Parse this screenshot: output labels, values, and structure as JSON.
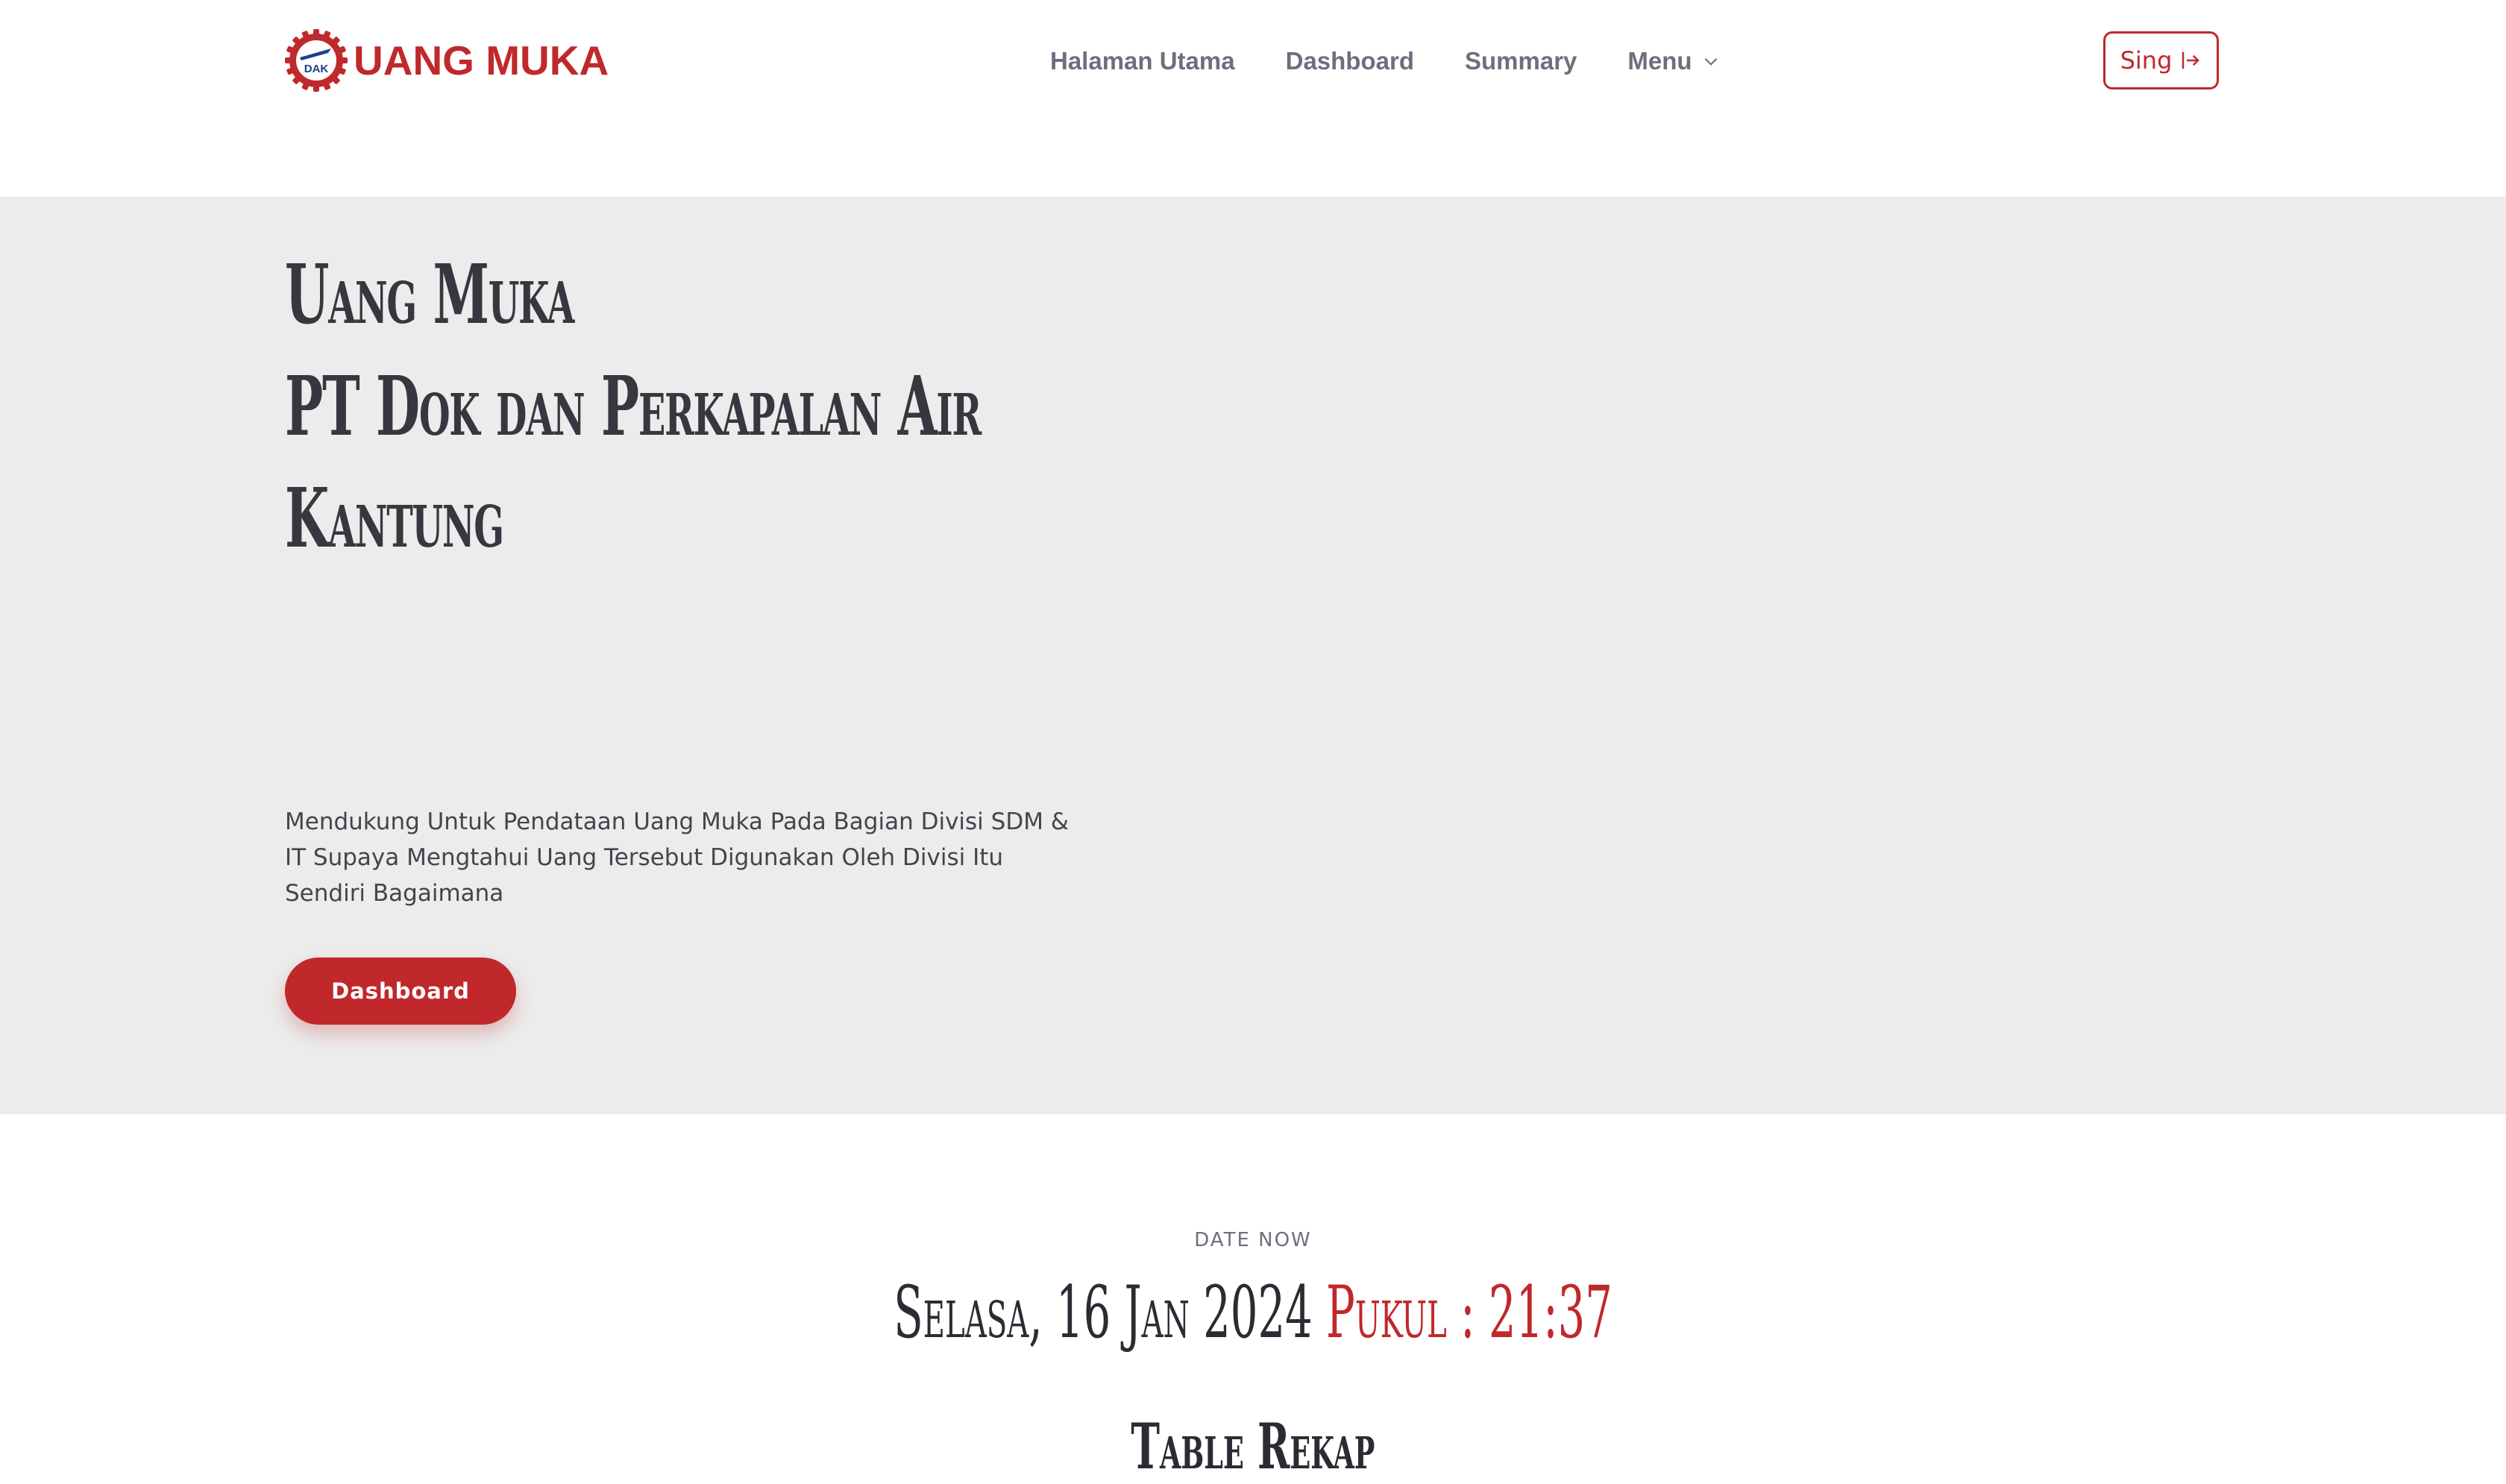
{
  "brand": {
    "logo_text": "DAK",
    "name": "UANG MUKA"
  },
  "nav": {
    "items": [
      {
        "label": "Halaman Utama"
      },
      {
        "label": "Dashboard"
      },
      {
        "label": "Summary"
      },
      {
        "label": "Menu"
      }
    ],
    "signin_label": "Sing",
    "signin_icon": "sign-in-icon",
    "menu_icon": "chevron-down-icon"
  },
  "hero": {
    "title_lines": [
      "Uang Muka",
      "PT Dok dan Perkapalan Air",
      "Kantung"
    ],
    "description": "Mendukung Untuk Pendataan Uang Muka Pada Bagian Divisi SDM & IT Supaya Mengtahui Uang Tersebut Digunakan Oleh Divisi Itu Sendiri Bagaimana",
    "button_label": "Dashboard"
  },
  "date_section": {
    "label": "DATE NOW",
    "date": "Selasa, 16 Jan 2024",
    "time_prefix": "Pukul :",
    "time": "21:37"
  },
  "table_section": {
    "heading": "Table Rekap"
  },
  "colors": {
    "accent": "#c0282b",
    "hero_bg": "#ececec",
    "text_dark": "#37373f",
    "nav_text": "#6e6e7d"
  }
}
